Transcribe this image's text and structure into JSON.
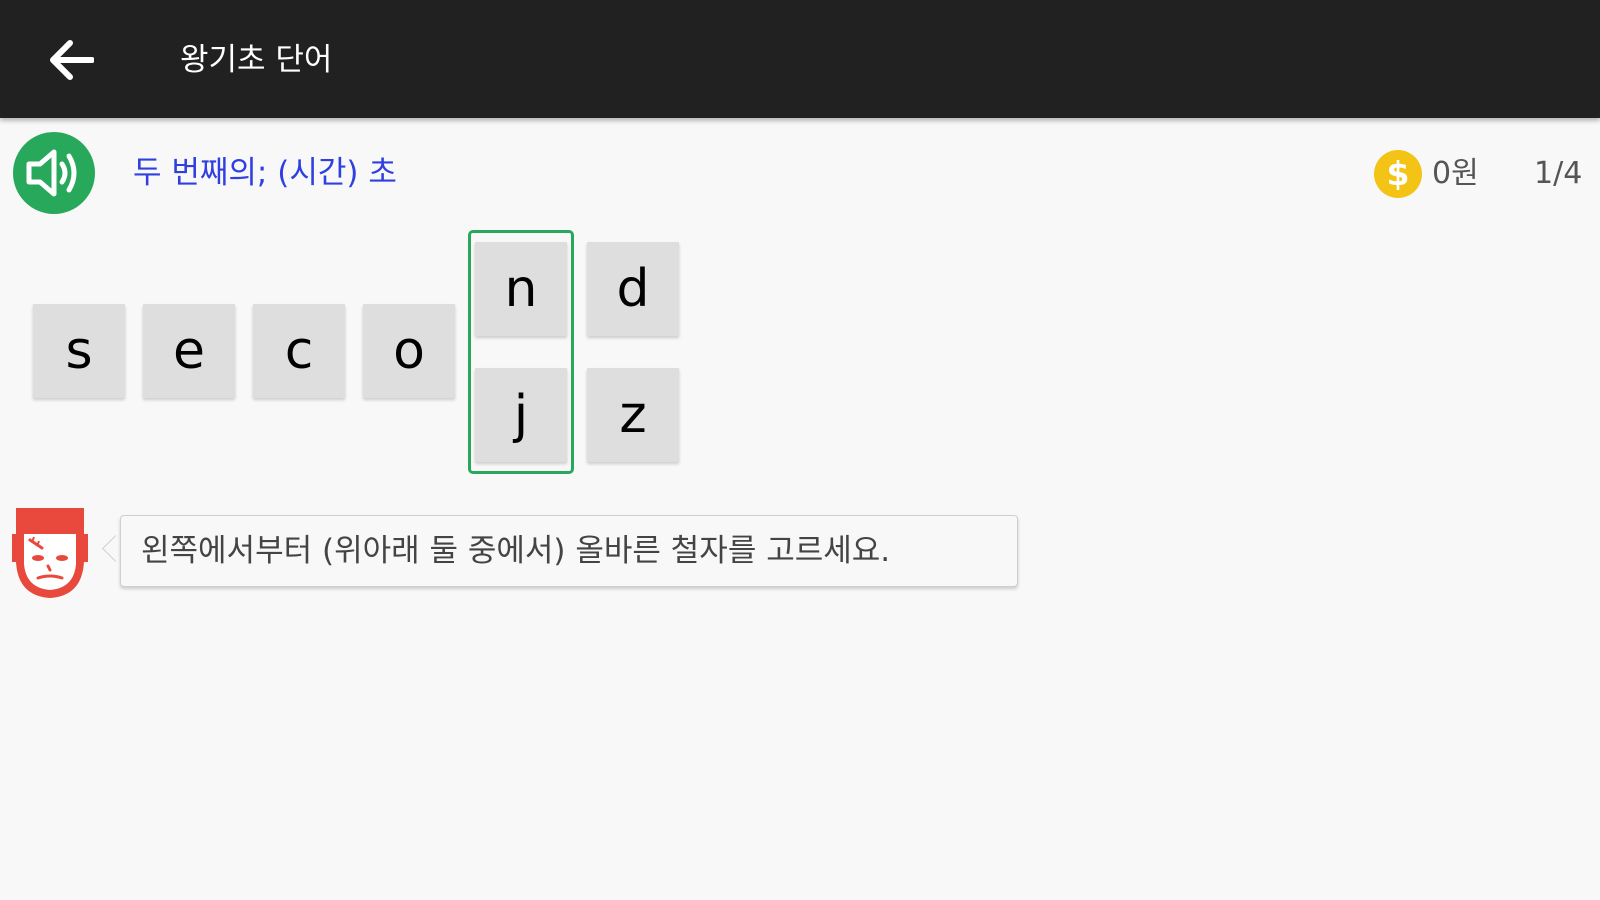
{
  "appbar": {
    "title": "왕기초 단어",
    "back_icon": "arrow-left-icon"
  },
  "quiz": {
    "speaker_icon": "speaker-volume-icon",
    "meaning": "두 번째의; (시간) 초",
    "coin_icon": "dollar-coin-icon",
    "coin_amount": "0원",
    "progress": "1/4",
    "placed_letters": [
      "s",
      "e",
      "c",
      "o"
    ],
    "active_choices": [
      "n",
      "j"
    ],
    "next_choices": [
      "d",
      "z"
    ]
  },
  "hint": {
    "avatar_icon": "frankenstein-monster-icon",
    "message": "왼쪽에서부터 (위아래 둘 중에서) 올바른 철자를 고르세요."
  },
  "colors": {
    "appbar": "#212121",
    "speaker": "#27a85a",
    "meaning_text": "#2f3fe0",
    "coin": "#f3c316",
    "selector_border": "#27a85a",
    "tile": "#dedede",
    "monster": "#e8493c"
  }
}
